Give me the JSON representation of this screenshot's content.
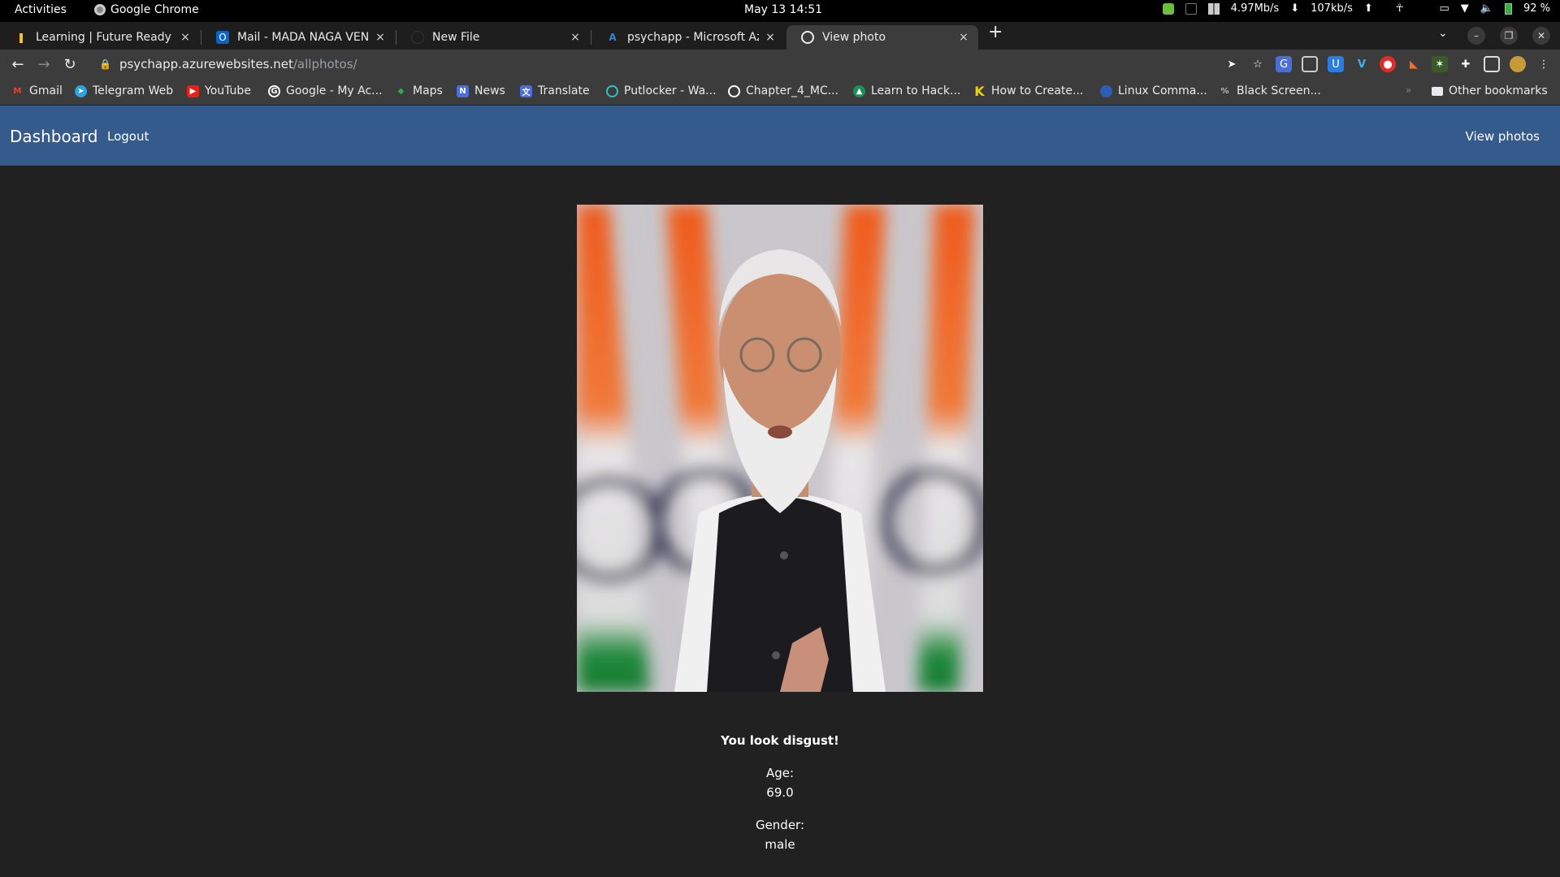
{
  "system": {
    "activities": "Activities",
    "app_name": "Google Chrome",
    "clock": "May 13  14:51",
    "net_down": "4.97Mb/s",
    "net_up": "107kb/s",
    "battery": "92 %"
  },
  "tabs": [
    {
      "title": "Learning | Future Ready T",
      "active": false
    },
    {
      "title": "Mail - MADA NAGA VENKA",
      "active": false
    },
    {
      "title": "New File",
      "active": false
    },
    {
      "title": "psychapp - Microsoft Azur",
      "active": false
    },
    {
      "title": "View photo",
      "active": true
    }
  ],
  "tab_close_glyph": "×",
  "newtab_glyph": "+",
  "address": {
    "host": "psychapp.azurewebsites.net",
    "path": "/allphotos/"
  },
  "bookmarks": [
    {
      "label": "Gmail",
      "icon": "gmail-icon"
    },
    {
      "label": "Telegram Web",
      "icon": "telegram-icon"
    },
    {
      "label": "YouTube",
      "icon": "youtube-icon"
    },
    {
      "label": "Google - My Ac...",
      "icon": "google-icon"
    },
    {
      "label": "Maps",
      "icon": "maps-icon"
    },
    {
      "label": "News",
      "icon": "news-icon"
    },
    {
      "label": "Translate",
      "icon": "translate-icon"
    },
    {
      "label": "Putlocker - Wa...",
      "icon": "putlocker-icon"
    },
    {
      "label": "Chapter_4_MC...",
      "icon": "globe-icon"
    },
    {
      "label": "Learn to Hack...",
      "icon": "hack-icon"
    },
    {
      "label": "How to Create...",
      "icon": "k-icon"
    },
    {
      "label": "Linux Comma...",
      "icon": "linux-icon"
    },
    {
      "label": "Black Screen...",
      "icon": "blackscreen-icon"
    }
  ],
  "other_bookmarks": "Other bookmarks",
  "page": {
    "brand": "Dashboard",
    "logout": "Logout",
    "view_photos": "View photos",
    "photo_alt": "Uploaded portrait photo",
    "emotion_text": "You look disgust!",
    "age_label": "Age:",
    "age_value": "69.0",
    "gender_label": "Gender:",
    "gender_value": "male"
  },
  "colors": {
    "navbar": "#355a8c",
    "page_bg": "#212121"
  }
}
